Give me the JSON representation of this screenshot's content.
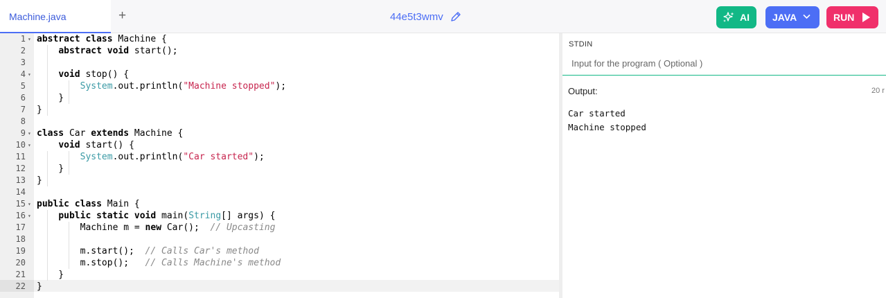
{
  "tabs": [
    {
      "label": "Machine.java",
      "active": true
    }
  ],
  "add_tab_label": "+",
  "file_id": "44e5t3wmv",
  "buttons": {
    "ai": {
      "label": "AI",
      "color": "#12b886"
    },
    "language": {
      "label": "JAVA",
      "color": "#4c6ef5"
    },
    "run": {
      "label": "RUN",
      "color": "#f0306b"
    }
  },
  "editor": {
    "active_line": 22,
    "lines": [
      "abstract class Machine {",
      "    abstract void start();",
      "",
      "    void stop() {",
      "        System.out.println(\"Machine stopped\");",
      "    }",
      "}",
      "",
      "class Car extends Machine {",
      "    void start() {",
      "        System.out.println(\"Car started\");",
      "    }",
      "}",
      "",
      "public class Main {",
      "    public static void main(String[] args) {",
      "        Machine m = new Car();  // Upcasting",
      "",
      "        m.start();  // Calls Car's method",
      "        m.stop();   // Calls Machine's method",
      "    }",
      "}"
    ],
    "fold_lines": [
      1,
      4,
      9,
      10,
      15,
      16
    ]
  },
  "stdin": {
    "label": "STDIN",
    "placeholder": "Input for the program ( Optional )"
  },
  "output": {
    "label": "Output:",
    "time": "20 r",
    "text": "Car started\nMachine stopped"
  },
  "colors": {
    "accent": "#4c6ef5",
    "stdin_underline": "#12b886",
    "string": "#c7254e",
    "type": "#3a9aa5",
    "comment": "#888888"
  }
}
